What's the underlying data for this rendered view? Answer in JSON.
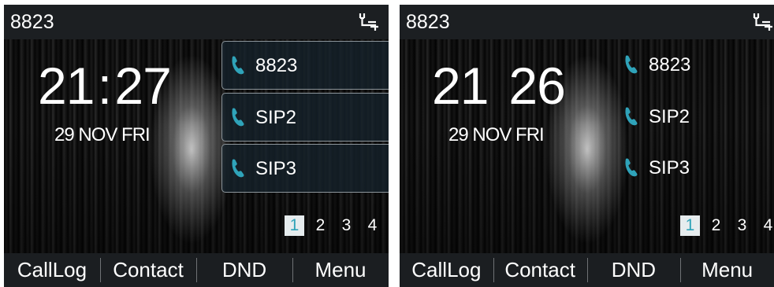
{
  "screens": [
    {
      "status_bar": {
        "account": "8823",
        "network_icon": "network-icon"
      },
      "clock": {
        "hours": "21",
        "separator": ":",
        "minutes": "27"
      },
      "date": "29 NOV FRI",
      "line_keys": [
        {
          "label": "8823",
          "icon": "phone-icon"
        },
        {
          "label": "SIP2",
          "icon": "phone-icon"
        },
        {
          "label": "SIP3",
          "icon": "phone-icon"
        }
      ],
      "pages": [
        "1",
        "2",
        "3",
        "4"
      ],
      "active_page": "1",
      "softkeys": [
        "CallLog",
        "Contact",
        "DND",
        "Menu"
      ]
    },
    {
      "status_bar": {
        "account": "8823",
        "network_icon": "network-icon"
      },
      "clock": {
        "hours": "21",
        "separator": "",
        "minutes": "26"
      },
      "date": "29 NOV FRI",
      "line_keys": [
        {
          "label": "8823",
          "icon": "phone-icon"
        },
        {
          "label": "SIP2",
          "icon": "phone-icon"
        },
        {
          "label": "SIP3",
          "icon": "phone-icon"
        }
      ],
      "pages": [
        "1",
        "2",
        "3",
        "4"
      ],
      "active_page": "1",
      "softkeys": [
        "CallLog",
        "Contact",
        "DND",
        "Menu"
      ]
    }
  ],
  "colors": {
    "accent": "#2fa3b9",
    "status_bar": "#1c1f22",
    "softkey_bar": "#1b1e21",
    "text": "#ffffff"
  }
}
